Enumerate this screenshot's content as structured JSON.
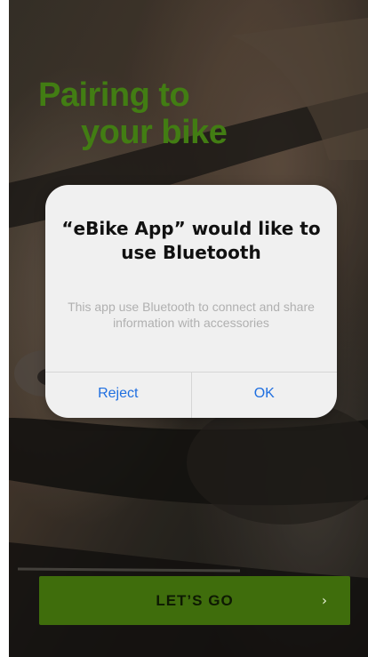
{
  "screen": {
    "headline_line1": "Pairing to",
    "headline_line2": "your bike"
  },
  "dialog": {
    "title": "“eBike App” would like to use Bluetooth",
    "message": "This app use Bluetooth to connect and share information with accessories",
    "reject_label": "Reject",
    "ok_label": "OK"
  },
  "cta": {
    "label": "LET’S GO",
    "chevron": "›"
  },
  "colors": {
    "accent_green": "#4c8f16",
    "button_green": "#3f6d0c",
    "dialog_button_blue": "#1f6fe0"
  },
  "icons": {
    "cta_chevron": "chevron-right-icon"
  }
}
